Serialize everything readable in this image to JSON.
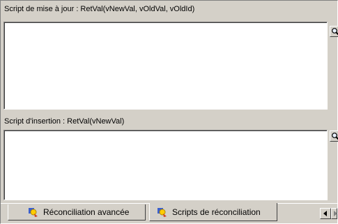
{
  "update_script": {
    "label": "Script de mise à jour : RetVal(vNewVal, vOldVal, vOldId)",
    "value": ""
  },
  "insert_script": {
    "label": "Script d'insertion : RetVal(vNewVal)",
    "value": ""
  },
  "tabs": [
    {
      "label": "Réconciliation avancée",
      "icon": "reconciliation-icon",
      "active": false
    },
    {
      "label": "Scripts de réconciliation",
      "icon": "reconciliation-icon",
      "active": true
    }
  ],
  "icons": {
    "zoom": "magnifier-icon",
    "scroll_left": "arrow-left-icon",
    "scroll_right": "arrow-right-icon"
  },
  "colors": {
    "window_bg": "#d4d0c8",
    "field_bg": "#ffffff",
    "accent_yellow": "#ffcc00"
  }
}
